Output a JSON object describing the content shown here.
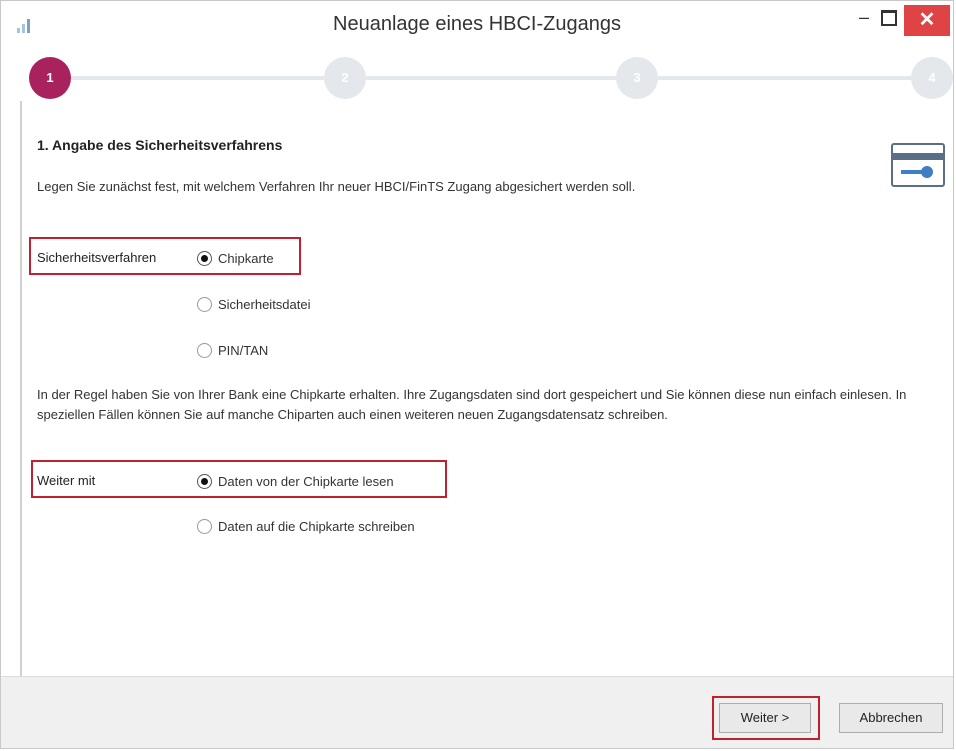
{
  "window": {
    "title": "Neuanlage eines HBCI-Zugangs",
    "minimize_glyph": "–",
    "close_glyph": "✕"
  },
  "stepper": {
    "steps": [
      "1",
      "2",
      "3",
      "4"
    ],
    "active_step": 1,
    "colors": {
      "active": "#a8235d",
      "inactive": "#e4e7ec"
    }
  },
  "section": {
    "heading": "1. Angabe des Sicherheitsverfahrens",
    "intro": "Legen Sie zunächst fest, mit welchem Verfahren Ihr neuer HBCI/FinTS Zugang abgesichert werden soll.",
    "icon": "card-key-icon"
  },
  "security": {
    "label": "Sicherheitsverfahren",
    "options": [
      {
        "label": "Chipkarte",
        "checked": true
      },
      {
        "label": "Sicherheitsdatei",
        "checked": false
      },
      {
        "label": "PIN/TAN",
        "checked": false
      }
    ]
  },
  "info_text": "In der Regel haben Sie von Ihrer Bank eine Chipkarte erhalten. Ihre Zugangsdaten sind dort gespeichert und Sie können diese nun einfach einlesen. In speziellen Fällen können Sie auf manche Chiparten auch einen weiteren neuen Zugangsdatensatz schreiben.",
  "continue_with": {
    "label": "Weiter mit",
    "options": [
      {
        "label": "Daten von der Chipkarte lesen",
        "checked": true
      },
      {
        "label": "Daten auf die Chipkarte schreiben",
        "checked": false
      }
    ]
  },
  "footer": {
    "next_label": "Weiter >",
    "cancel_label": "Abbrechen"
  },
  "colors": {
    "highlight": "#c0212e",
    "close_button": "#e04343"
  }
}
